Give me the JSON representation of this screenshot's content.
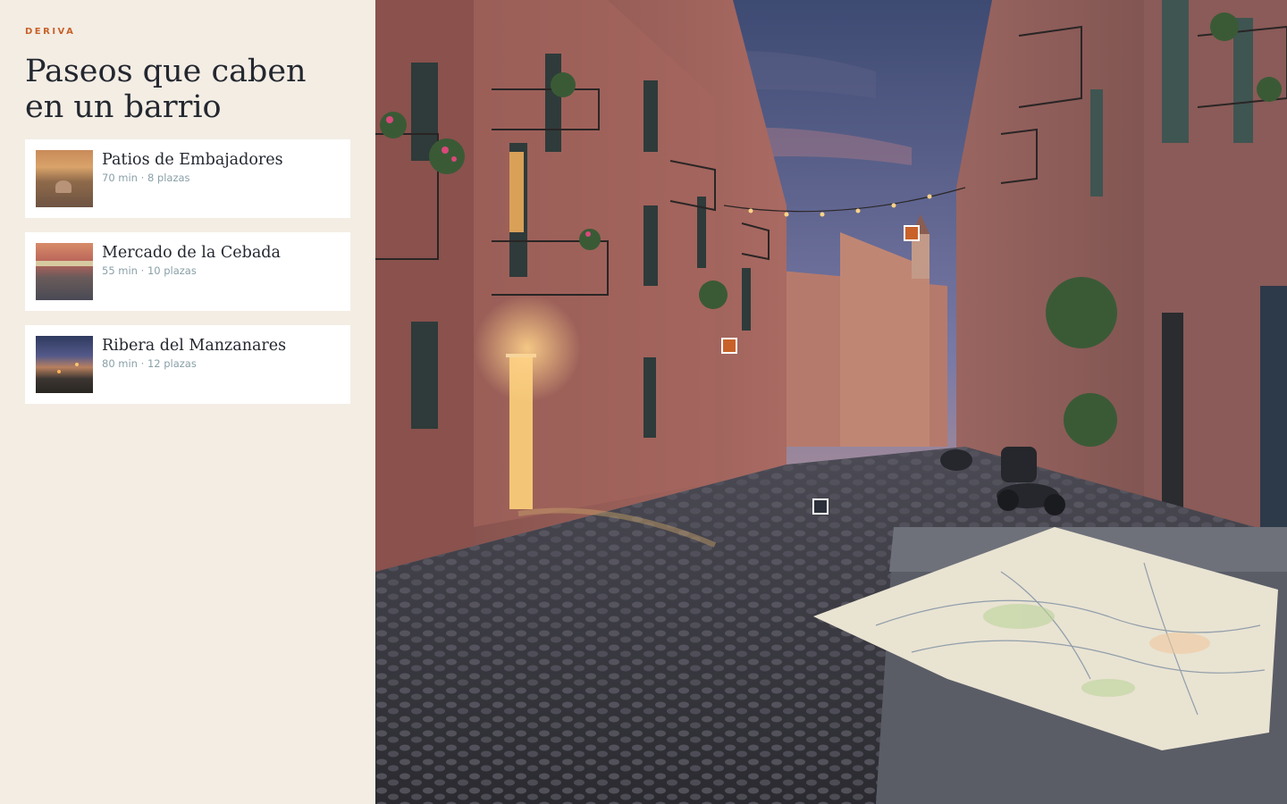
{
  "brand": "DERIVA",
  "title": "Paseos que caben en un barrio",
  "routes": [
    {
      "name": "Patios de Embajadores",
      "meta": "70 min · 8 plazas"
    },
    {
      "name": "Mercado de la Cebada",
      "meta": "55 min · 10 plazas"
    },
    {
      "name": "Ribera del Manzanares",
      "meta": "80 min · 12 plazas"
    }
  ],
  "colors": {
    "accent": "#c8622a",
    "panel": "#f3ede4",
    "ink": "#23272f",
    "meta": "#8aa0a8"
  },
  "markers": [
    {
      "style": "orange"
    },
    {
      "style": "orange"
    },
    {
      "style": "dark"
    }
  ]
}
